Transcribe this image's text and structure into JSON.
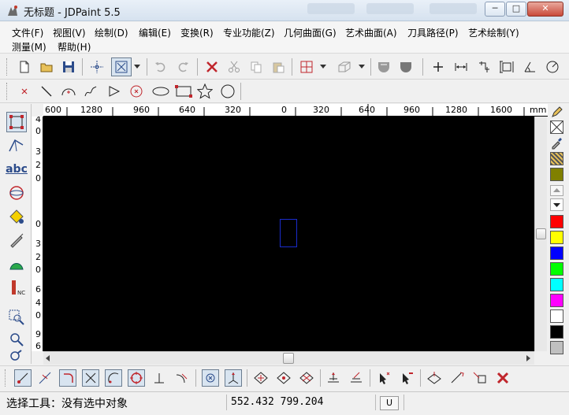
{
  "window": {
    "title": "无标题 - JDPaint 5.5",
    "minimize_glyph": "─",
    "maximize_glyph": "□",
    "close_glyph": "✕"
  },
  "menu": [
    "文件(F)",
    "视图(V)",
    "绘制(D)",
    "编辑(E)",
    "变换(R)",
    "专业功能(Z)",
    "几何曲面(G)",
    "艺术曲面(A)",
    "刀具路径(P)",
    "艺术绘制(Y)",
    "测量(M)",
    "帮助(H)"
  ],
  "ruler": {
    "h_labels": [
      "600",
      "1280",
      "960",
      "640",
      "320",
      "0",
      "320",
      "640",
      "960",
      "1280",
      "1600",
      "mm"
    ],
    "v_labels": [
      "4",
      "0",
      "3",
      "2",
      "0",
      "0",
      "3",
      "2",
      "0",
      "6",
      "4",
      "0",
      "9",
      "6",
      "0"
    ]
  },
  "palette": {
    "colors": [
      "#808000",
      "#ff0000",
      "#ffff00",
      "#0000ff",
      "#00ff00",
      "#00ffff",
      "#ff00ff",
      "#ffffff",
      "#000000",
      "#c0c0c0"
    ]
  },
  "left_tools": {
    "text_tool_label": "abc"
  },
  "status": {
    "message": "选择工具：没有选中对象",
    "coords": "552.432  799.204",
    "unit_button": "U"
  }
}
